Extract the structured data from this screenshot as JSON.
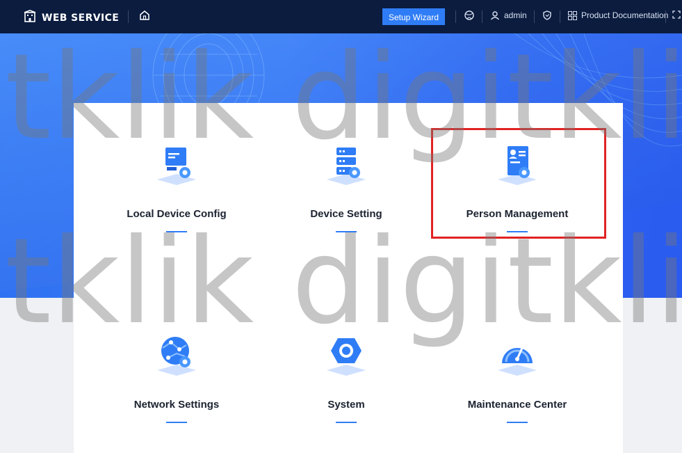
{
  "topbar": {
    "app_title": "WEB SERVICE",
    "setup_wizard": "Setup Wizard",
    "user": "admin",
    "product_docs": "Product Documentation"
  },
  "tiles": [
    {
      "label": "Local Device Config",
      "icon": "monitor-gear-icon"
    },
    {
      "label": "Device Setting",
      "icon": "server-gear-icon"
    },
    {
      "label": "Person Management",
      "icon": "person-card-gear-icon"
    },
    {
      "label": "Network Settings",
      "icon": "globe-network-gear-icon"
    },
    {
      "label": "System",
      "icon": "system-gear-icon"
    },
    {
      "label": "Maintenance Center",
      "icon": "gauge-icon"
    }
  ],
  "watermark": {
    "text": "itklik digitklik"
  },
  "colors": {
    "topbar": "#0b1c3f",
    "accent": "#2f7df6",
    "banner": "#3a7bf8",
    "highlight": "#e12222"
  }
}
